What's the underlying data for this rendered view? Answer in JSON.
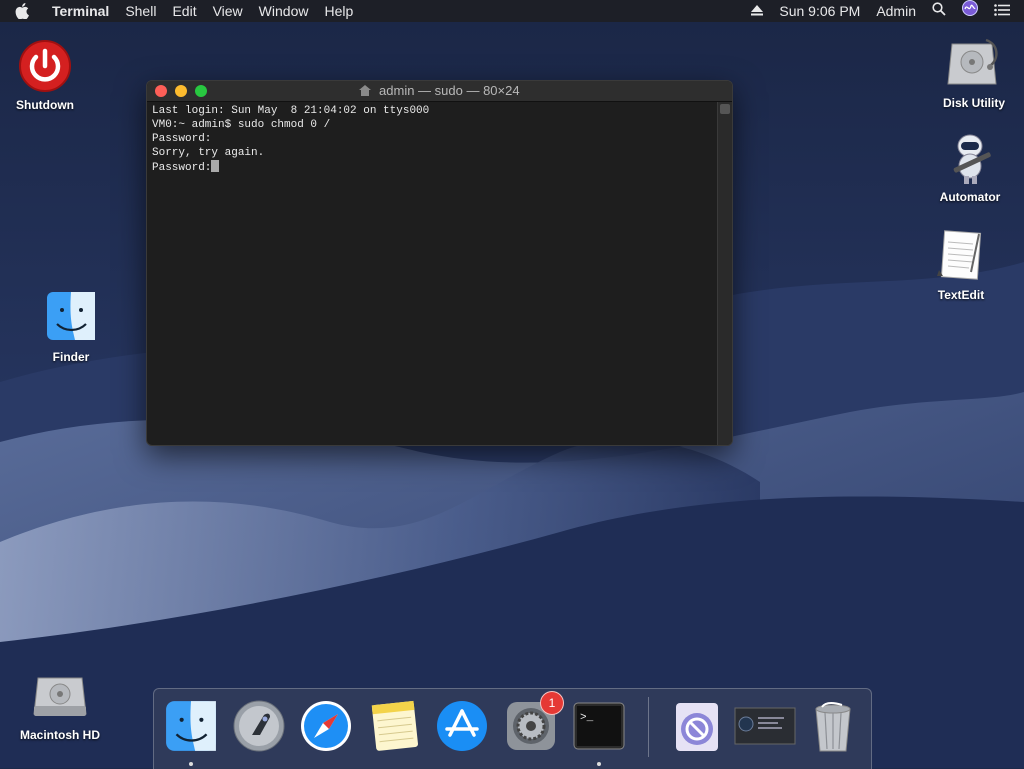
{
  "menubar": {
    "app_name": "Terminal",
    "menus": [
      "Shell",
      "Edit",
      "View",
      "Window",
      "Help"
    ],
    "clock": "Sun 9:06 PM",
    "user": "Admin"
  },
  "desktop_icons": {
    "shutdown": "Shutdown",
    "finder": "Finder",
    "macintosh_hd": "Macintosh HD",
    "disk_utility": "Disk Utility",
    "automator": "Automator",
    "textedit": "TextEdit"
  },
  "terminal": {
    "title": "admin — sudo — 80×24",
    "lines": [
      "Last login: Sun May  8 21:04:02 on ttys000",
      "VM0:~ admin$ sudo chmod 0 /",
      "Password:",
      "Sorry, try again.",
      "Password:"
    ]
  },
  "dock": {
    "apps": [
      "finder-icon",
      "launchpad-icon",
      "safari-icon",
      "notes-icon",
      "app-store-icon",
      "system-preferences-icon",
      "terminal-icon",
      "preview-icon",
      "screenshot-icon",
      "trash-icon"
    ],
    "system_preferences_badge": "1"
  },
  "colors": {
    "close": "#fe5f57",
    "minimize": "#febc2e",
    "zoom": "#28c840",
    "badge": "#e53935"
  }
}
